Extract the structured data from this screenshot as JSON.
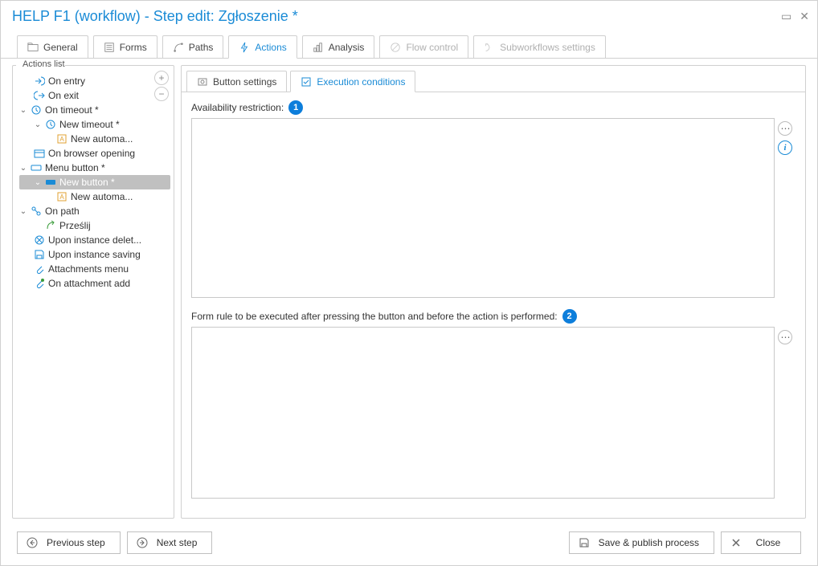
{
  "window": {
    "title": "HELP F1 (workflow) - Step edit: Zgłoszenie *"
  },
  "mainTabs": {
    "general": "General",
    "forms": "Forms",
    "paths": "Paths",
    "actions": "Actions",
    "analysis": "Analysis",
    "flowControl": "Flow control",
    "subworkflows": "Subworkflows settings"
  },
  "sidebar": {
    "title": "Actions list",
    "items": {
      "onEntry": "On entry",
      "onExit": "On exit",
      "onTimeout": "On timeout *",
      "newTimeout": "New timeout *",
      "newAutoma1": "New automa...",
      "onBrowserOpening": "On browser opening",
      "menuButton": "Menu button *",
      "newButton": "New button *",
      "newAutoma2": "New automa...",
      "onPath": "On path",
      "przeslij": "Prześlij",
      "uponInstanceDelete": "Upon instance delet...",
      "uponInstanceSaving": "Upon instance saving",
      "attachmentsMenu": "Attachments menu",
      "onAttachmentAdd": "On attachment add"
    }
  },
  "subTabs": {
    "buttonSettings": "Button settings",
    "executionConditions": "Execution conditions"
  },
  "content": {
    "availabilityLabel": "Availability restriction:",
    "callout1": "1",
    "formRuleLabel": "Form rule to be executed after pressing the button and before the action is performed:",
    "callout2": "2"
  },
  "footer": {
    "previousStep": "Previous step",
    "nextStep": "Next step",
    "savePublish": "Save & publish process",
    "close": "Close"
  }
}
